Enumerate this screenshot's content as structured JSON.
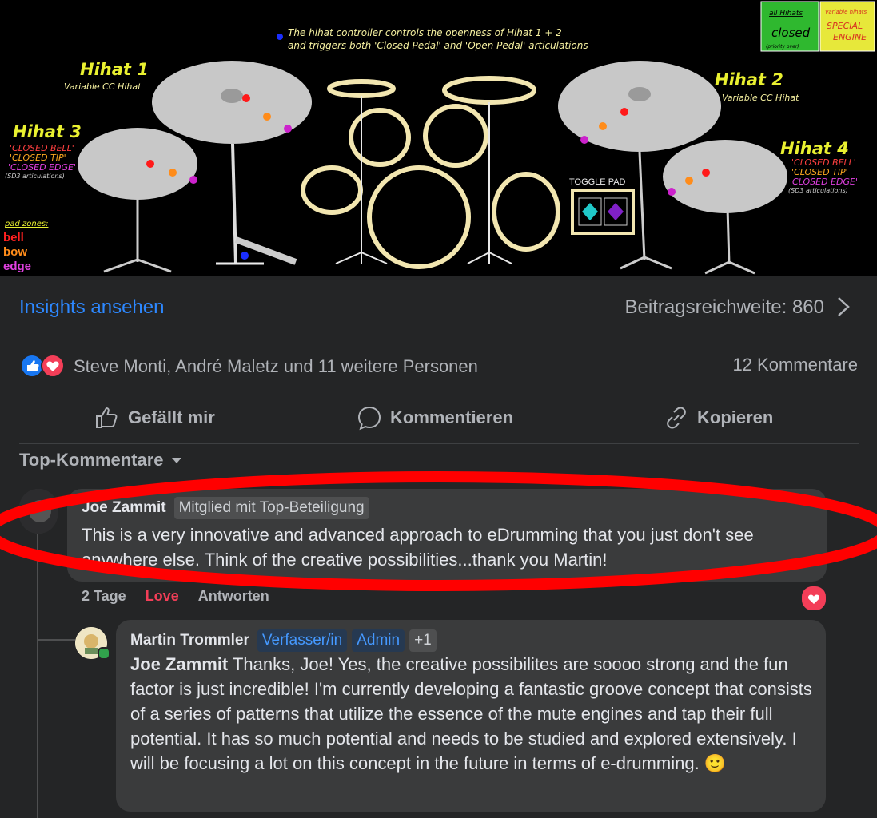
{
  "banner": {
    "caption_line1": "The hihat controller controls the openness of Hihat 1 + 2",
    "caption_line2": "and triggers both 'Closed Pedal' and 'Open Pedal' articulations",
    "hihat1_title": "Hihat 1",
    "hihat1_sub": "Variable CC Hihat",
    "hihat2_title": "Hihat 2",
    "hihat2_sub": "Variable CC Hihat",
    "hihat3_title": "Hihat 3",
    "hihat4_title": "Hihat 4",
    "closed_bell": "'CLOSED BELL'",
    "closed_tip": "'CLOSED TIP'",
    "closed_edge": "'CLOSED EDGE'",
    "sd3_note": "(SD3 articulations)",
    "pad_zones_label": "pad zones:",
    "zone_bell": "bell",
    "zone_bow": "bow",
    "zone_edge": "edge",
    "toggle_pad": "TOGGLE PAD",
    "btn_all_hihats": "all Hihats",
    "btn_closed": "closed",
    "btn_priority": "(priority over)",
    "btn_variable": "Variable hihats",
    "btn_special": "SPECIAL",
    "btn_engine": "ENGINE"
  },
  "insights": {
    "link_label": "Insights ansehen",
    "reach_label": "Beitragsreichweite: 860"
  },
  "reactions": {
    "names": "Steve Monti, André Maletz und 11 weitere Personen",
    "comments": "12 Kommentare"
  },
  "actions": {
    "like": "Gefällt mir",
    "comment": "Kommentieren",
    "copy": "Kopieren"
  },
  "filter": {
    "label": "Top-Kommentare"
  },
  "comment1": {
    "author": "Joe Zammit",
    "badge": "Mitglied mit Top-Beteiligung",
    "text": "This is a very innovative and advanced approach to eDrumming that you just don't see anywhere else. Think of the creative possibilities...thank you Martin!",
    "age": "2 Tage",
    "reaction": "Love",
    "reply": "Antworten"
  },
  "comment2": {
    "author": "Martin Trommler",
    "badge1": "Verfasser/in",
    "badge2": "Admin",
    "badge3": "+1",
    "mention": "Joe Zammit",
    "text": " Thanks, Joe! Yes, the creative possibilites are soooo strong and the fun factor is just incredible! I'm currently developing a fantastic groove concept that consists of a series of patterns that utilize the essence of the mute engines and tap their full potential. It has so much potential and needs to be studied and explored extensively. I will be focusing a lot on this concept in the future in terms of e-drumming. 🙂"
  },
  "colors": {
    "link_blue": "#2d88ff",
    "love_red": "#f33e58",
    "annotation_red": "#ff0000"
  }
}
